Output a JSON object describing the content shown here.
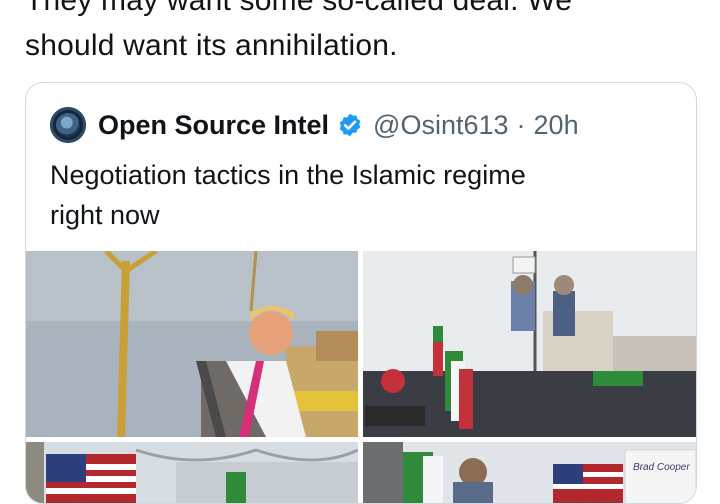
{
  "tweet": {
    "text_line1": "They may want some so-called deal. We",
    "text_line2": "should want its annihilation."
  },
  "quote": {
    "display_name": "Open Source Intel",
    "verified": true,
    "handle": "@Osint613",
    "separator": "·",
    "time": "20h",
    "text_line1": "Negotiation tactics in the Islamic regime",
    "text_line2": "right now",
    "photo_sign_text": "Brad Cooper"
  },
  "colors": {
    "verified_badge": "#1d9bf0",
    "border": "#cfd9de",
    "secondary_text": "#536471"
  },
  "icons": {
    "verified": "verified-badge-icon",
    "avatar": "globe-logo"
  }
}
